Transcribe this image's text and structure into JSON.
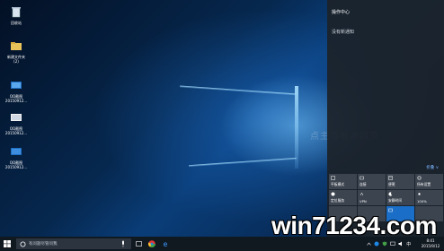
{
  "desktop": {
    "icons": [
      {
        "label": "回收站",
        "icon": "recycle-bin-icon"
      },
      {
        "label": "新建文件夹\n(2)",
        "icon": "folder-icon"
      },
      {
        "label": "QQ截图\n20150912...",
        "icon": "screenshot-file-icon"
      },
      {
        "label": "QQ截图\n20150912...",
        "icon": "screenshot-file-icon"
      },
      {
        "label": "QQ截图\n20150912...",
        "icon": "screenshot-file-icon"
      }
    ],
    "watermark": "点主看看源网页"
  },
  "action_center": {
    "title": "操作中心",
    "empty_message": "没有新通知",
    "collapse_label": "折叠 ∨",
    "tiles": [
      {
        "label": "平板模式",
        "icon": "tablet-mode-icon",
        "active": false
      },
      {
        "label": "连接",
        "icon": "connect-icon",
        "active": false
      },
      {
        "label": "便笺",
        "icon": "note-icon",
        "active": false
      },
      {
        "label": "所有设置",
        "icon": "settings-icon",
        "active": false
      },
      {
        "label": "定位服务",
        "icon": "location-icon",
        "active": false
      },
      {
        "label": "VPN",
        "icon": "vpn-icon",
        "active": false
      },
      {
        "label": "安静时间",
        "icon": "quiet-hours-icon",
        "active": false
      },
      {
        "label": "100%",
        "icon": "brightness-icon",
        "active": false
      },
      {
        "label": "",
        "icon": "blank-tile",
        "active": false
      },
      {
        "label": "",
        "icon": "blank-tile",
        "active": false
      },
      {
        "label": "",
        "icon": "network-icon",
        "active": true
      },
      {
        "label": "",
        "icon": "blank-tile",
        "active": false
      }
    ]
  },
  "brand": {
    "text": "win71234.com"
  },
  "taskbar": {
    "search_placeholder": "有问题尽管问我",
    "clock_time": "8:41",
    "clock_date": "2015/9/12",
    "colors": {
      "accent": "#1a6ec7",
      "taskbar": "#101820"
    }
  }
}
